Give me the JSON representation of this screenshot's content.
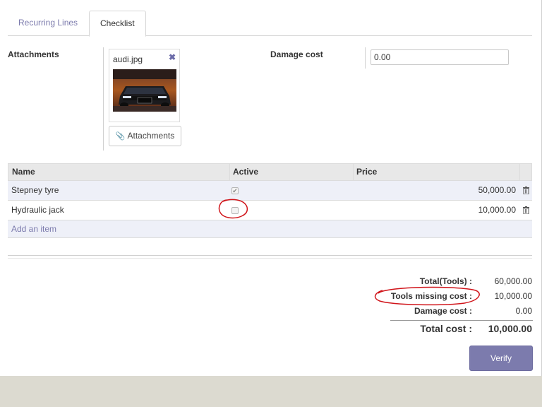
{
  "tabs": [
    {
      "label": "Recurring Lines"
    },
    {
      "label": "Checklist"
    }
  ],
  "attachments": {
    "label": "Attachments",
    "file_name": "audi.jpg",
    "remove_icon": "close-icon",
    "button_label": "Attachments",
    "button_icon": "paperclip-icon"
  },
  "damage": {
    "label": "Damage cost",
    "value": "0.00"
  },
  "table": {
    "headers": [
      "Name",
      "Active",
      "Price"
    ],
    "rows": [
      {
        "name": "Stepney tyre",
        "active": true,
        "price": "50,000.00"
      },
      {
        "name": "Hydraulic jack",
        "active": false,
        "price": "10,000.00"
      }
    ],
    "add_item": "Add an item"
  },
  "totals": {
    "tools_label": "Total(Tools) :",
    "tools_value": "60,000.00",
    "missing_label": "Tools missing cost :",
    "missing_value": "10,000.00",
    "damage_label": "Damage cost :",
    "damage_value": "0.00",
    "total_label": "Total cost :",
    "total_value": "10,000.00"
  },
  "verify_label": "Verify",
  "colors": {
    "accent": "#7c7bad",
    "annotation": "#d0141a"
  }
}
